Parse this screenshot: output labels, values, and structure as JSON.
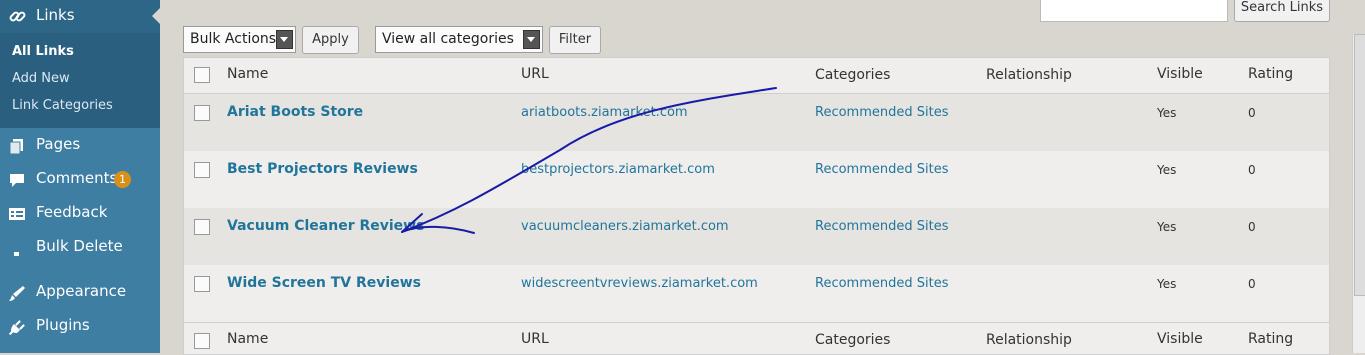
{
  "sidebar": {
    "current": "Links",
    "submenu": [
      "All Links",
      "Add New",
      "Link Categories"
    ],
    "items": [
      {
        "label": "Pages",
        "icon": "pages-icon"
      },
      {
        "label": "Comments",
        "icon": "comments-icon",
        "badge": "1"
      },
      {
        "label": "Feedback",
        "icon": "feedback-icon"
      },
      {
        "label": "Bulk Delete",
        "icon": "bulk-delete-icon"
      },
      {
        "label": "Appearance",
        "icon": "appearance-icon"
      },
      {
        "label": "Plugins",
        "icon": "plugins-icon"
      }
    ]
  },
  "toolbar": {
    "bulk_actions": "Bulk Actions",
    "apply": "Apply",
    "category_filter": "View all categories",
    "filter": "Filter",
    "search_button": "Search Links"
  },
  "table": {
    "columns": [
      "Name",
      "URL",
      "Categories",
      "Relationship",
      "Visible",
      "Rating"
    ],
    "rows": [
      {
        "name": "Ariat Boots Store",
        "url": "ariatboots.ziamarket.com",
        "categories": "Recommended Sites",
        "relationship": "",
        "visible": "Yes",
        "rating": "0"
      },
      {
        "name": "Best Projectors Reviews",
        "url": "bestprojectors.ziamarket.com",
        "categories": "Recommended Sites",
        "relationship": "",
        "visible": "Yes",
        "rating": "0"
      },
      {
        "name": "Vacuum Cleaner Reviews",
        "url": "vacuumcleaners.ziamarket.com",
        "categories": "Recommended Sites",
        "relationship": "",
        "visible": "Yes",
        "rating": "0"
      },
      {
        "name": "Wide Screen TV Reviews",
        "url": "widescreentvreviews.ziamarket.com",
        "categories": "Recommended Sites",
        "relationship": "",
        "visible": "Yes",
        "rating": "0"
      }
    ]
  },
  "colors": {
    "sidebar": "#3f7ea3",
    "sidebar_active": "#2e6688",
    "link": "#21759b",
    "badge": "#d8901a",
    "annotation": "#1a1aa8"
  }
}
